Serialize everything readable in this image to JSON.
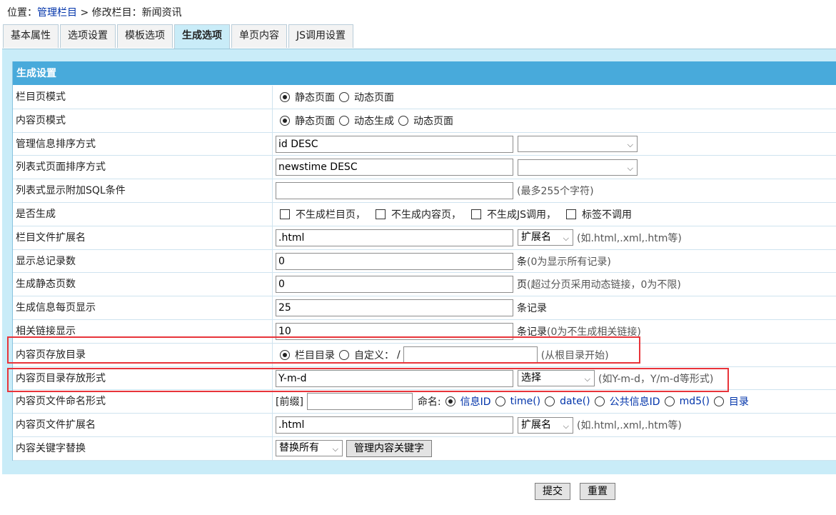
{
  "breadcrumb": {
    "prefix": "位置：",
    "link": "管理栏目",
    "rest": " > 修改栏目：新闻资讯"
  },
  "tabs": [
    "基本属性",
    "选项设置",
    "模板选项",
    "生成选项",
    "单页内容",
    "JS调用设置"
  ],
  "active_tab": "生成选项",
  "section_title": "生成设置",
  "rows": {
    "list_mode": {
      "label": "栏目页模式",
      "opt1": "静态页面",
      "opt2": "动态页面"
    },
    "content_mode": {
      "label": "内容页模式",
      "opt1": "静态页面",
      "opt2": "动态生成",
      "opt3": "动态页面"
    },
    "manage_sort": {
      "label": "管理信息排序方式",
      "value": "id DESC"
    },
    "list_sort": {
      "label": "列表式页面排序方式",
      "value": "newstime DESC"
    },
    "list_sql": {
      "label": "列表式显示附加SQL条件",
      "value": "",
      "hint": "(最多255个字符)"
    },
    "generate": {
      "label": "是否生成",
      "opt1": "不生成栏目页，",
      "opt2": "不生成内容页，",
      "opt3": "不生成JS调用，",
      "opt4": "标签不调用"
    },
    "list_ext": {
      "label": "栏目文件扩展名",
      "value": ".html",
      "select": "扩展名",
      "hint": "(如.html,.xml,.htm等)"
    },
    "total_records": {
      "label": "显示总记录数",
      "value": "0",
      "hint_main": "条",
      "hint": "(0为显示所有记录)"
    },
    "static_pages": {
      "label": "生成静态页数",
      "value": "0",
      "hint_main": "页",
      "hint": "(超过分页采用动态链接，0为不限)"
    },
    "per_page": {
      "label": "生成信息每页显示",
      "value": "25",
      "hint_main": "条记录"
    },
    "related_links": {
      "label": "相关链接显示",
      "value": "10",
      "hint_main": "条记录",
      "hint": "(0为不生成相关链接)"
    },
    "content_dir": {
      "label": "内容页存放目录",
      "opt1": "栏目目录",
      "opt2": "自定义：",
      "slash": "/",
      "value": "",
      "hint": "(从根目录开始)"
    },
    "dir_format": {
      "label": "内容页目录存放形式",
      "value": "Y-m-d",
      "select": "选择",
      "hint": "(如Y-m-d，Y/m-d等形式)"
    },
    "file_naming": {
      "label": "内容页文件命名形式",
      "prefix_label": "[前缀]",
      "prefix_value": "",
      "naming_label": "命名:",
      "opts": [
        "信息ID",
        "time()",
        "date()",
        "公共信息ID",
        "md5()",
        "目录"
      ]
    },
    "content_ext": {
      "label": "内容页文件扩展名",
      "value": ".html",
      "select": "扩展名",
      "hint": "(如.html,.xml,.htm等)"
    },
    "keyword_replace": {
      "label": "内容关键字替换",
      "select": "替换所有",
      "button": "管理内容关键字"
    }
  },
  "buttons": {
    "submit": "提交",
    "reset": "重置"
  },
  "colors": {
    "header_bg": "#48aadb",
    "panel_bg": "#c9ecf8",
    "highlight_border": "#e8343a",
    "link": "#0033aa"
  }
}
